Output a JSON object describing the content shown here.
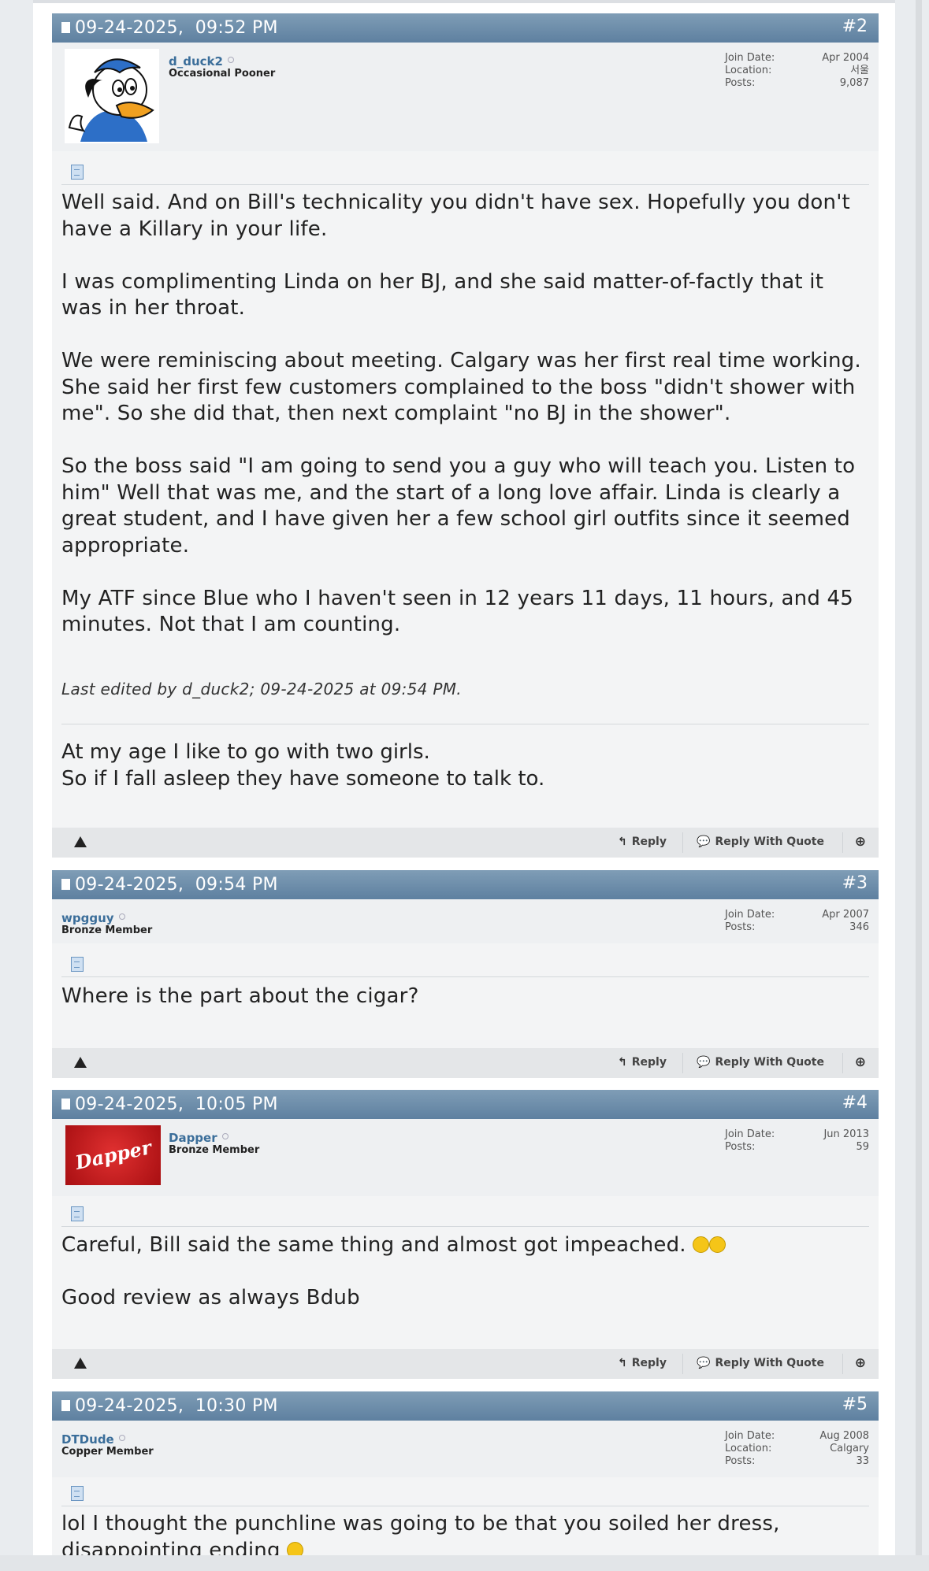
{
  "posts": [
    {
      "date": "09-24-2025,",
      "time": "09:52 PM",
      "number": "#2",
      "user": {
        "name": "d_duck2",
        "title": "Occasional Pooner"
      },
      "meta_labels": [
        "Join Date:",
        "Location:",
        "Posts:"
      ],
      "meta_values": [
        "Apr 2004",
        "서울",
        "9,087"
      ],
      "body": [
        "Well said. And on Bill's technicality you didn't have sex. Hopefully you don't have a Killary in your life.",
        "I was complimenting Linda on her BJ, and she said matter-of-factly that it was in her throat.",
        "We were reminiscing about meeting. Calgary was her first real time working. She said her first few customers complained to the boss \"didn't shower with me\". So she did that, then next complaint \"no BJ in the shower\".",
        "So the boss said \"I am going to send you a guy who will teach you. Listen to him\" Well that was me, and the start of a long love affair. Linda is clearly a great student, and I have given her a few school girl outfits since it seemed appropriate.",
        "My ATF since Blue who I haven't seen in 12 years 11 days, 11 hours, and 45 minutes. Not that I am counting."
      ],
      "edited": "Last edited by d_duck2; 09-24-2025 at 09:54 PM.",
      "signature": [
        "At my age I like to go with two girls.",
        "So if I fall asleep they have someone to talk to."
      ]
    },
    {
      "date": "09-24-2025,",
      "time": "09:54 PM",
      "number": "#3",
      "user": {
        "name": "wpgguy",
        "title": "Bronze Member"
      },
      "meta_labels": [
        "Join Date:",
        "Posts:"
      ],
      "meta_values": [
        "Apr 2007",
        "346"
      ],
      "body": [
        "Where is the part about the cigar?"
      ]
    },
    {
      "date": "09-24-2025,",
      "time": "10:05 PM",
      "number": "#4",
      "user": {
        "name": "Dapper",
        "title": "Bronze Member",
        "avatar_text": "Dapper"
      },
      "meta_labels": [
        "Join Date:",
        "Posts:"
      ],
      "meta_values": [
        "Jun 2013",
        "59"
      ],
      "body": [
        "Careful, Bill said the same thing and almost got impeached.",
        "Good review as always Bdub"
      ]
    },
    {
      "date": "09-24-2025,",
      "time": "10:30 PM",
      "number": "#5",
      "user": {
        "name": "DTDude",
        "title": "Copper Member"
      },
      "meta_labels": [
        "Join Date:",
        "Location:",
        "Posts:"
      ],
      "meta_values": [
        "Aug 2008",
        "Calgary",
        "33"
      ],
      "body": [
        "lol I thought the punchline was going to be that you soiled her dress, disappointing ending"
      ]
    }
  ],
  "actions": {
    "reply": "Reply",
    "reply_quote": "Reply With Quote"
  },
  "colors": {
    "header": "#6a8aa8",
    "link": "#3b6e9a"
  }
}
